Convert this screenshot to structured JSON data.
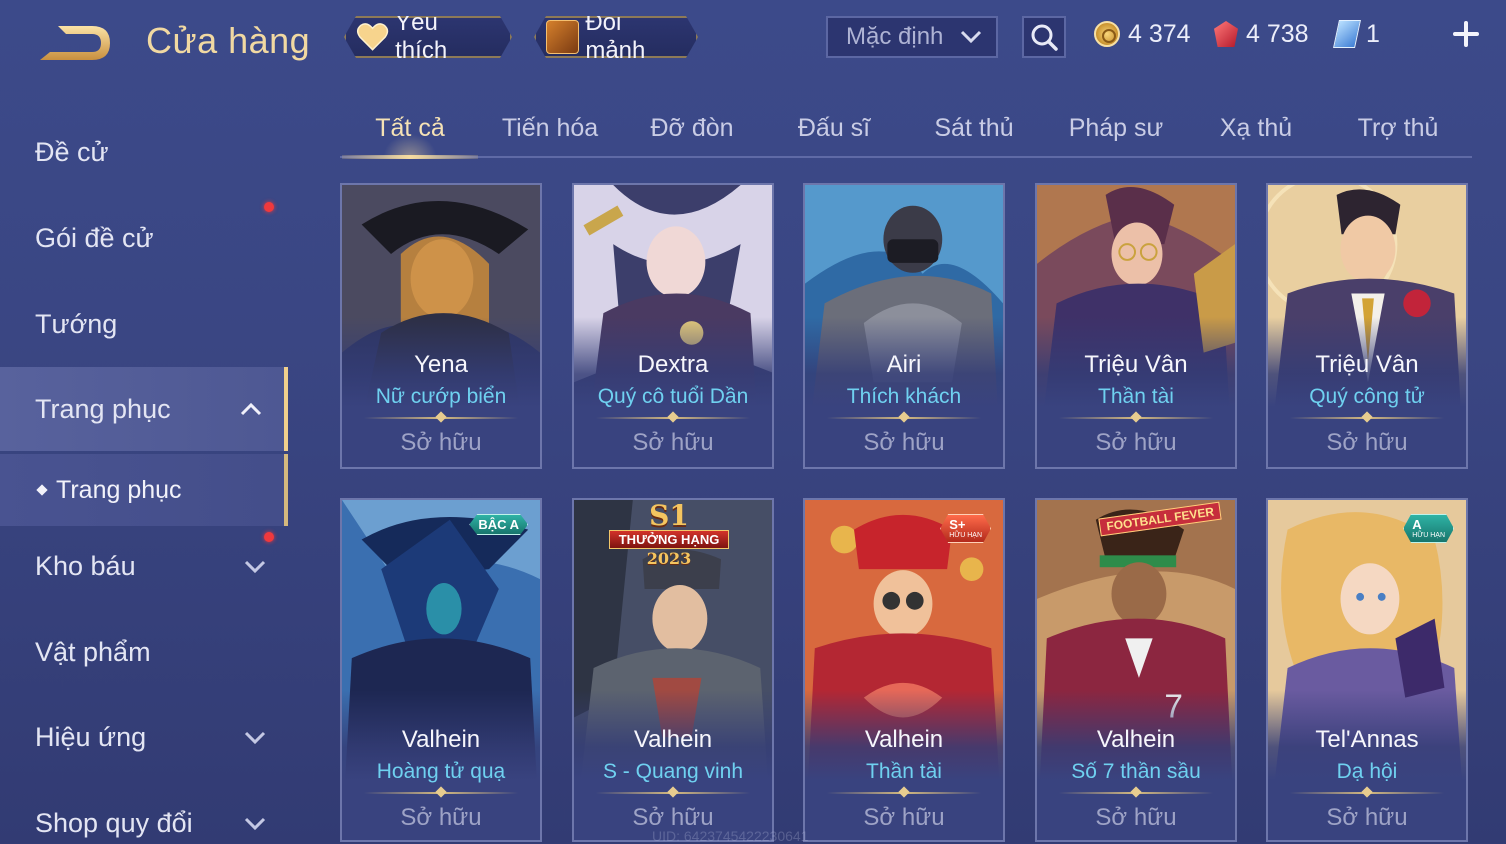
{
  "header": {
    "title": "Cửa hàng",
    "favorites_label": "Yêu thích",
    "fragments_label": "Đổi mảnh",
    "sort_value": "Mặc định"
  },
  "currencies": {
    "gold": "4 374",
    "ruby": "4 738",
    "token": "1"
  },
  "sidebar": {
    "items": [
      {
        "label": "Đề cử"
      },
      {
        "label": "Gói đề cử"
      },
      {
        "label": "Tướng"
      },
      {
        "label": "Trang phục"
      },
      {
        "label": "Kho báu"
      },
      {
        "label": "Vật phẩm"
      },
      {
        "label": "Hiệu ứng"
      },
      {
        "label": "Shop quy đổi"
      }
    ],
    "sub_item": "Trang phục"
  },
  "tabs": [
    "Tất cả",
    "Tiến hóa",
    "Đỡ đòn",
    "Đấu sĩ",
    "Sát thủ",
    "Pháp sư",
    "Xạ thủ",
    "Trợ thủ"
  ],
  "cards": [
    {
      "hero": "Yena",
      "skin": "Nữ cướp biển",
      "status": "Sở hữu",
      "accent": "#6a5a3c"
    },
    {
      "hero": "Dextra",
      "skin": "Quý cô tuổi Dần",
      "status": "Sở hữu",
      "accent": "#8e7aa8"
    },
    {
      "hero": "Airi",
      "skin": "Thích khách",
      "status": "Sở hữu",
      "accent": "#3b82c4"
    },
    {
      "hero": "Triệu Vân",
      "skin": "Thần tài",
      "status": "Sở hữu",
      "accent": "#8b3a4a"
    },
    {
      "hero": "Triệu Vân",
      "skin": "Quý công tử",
      "status": "Sở hữu",
      "accent": "#c9a46a"
    },
    {
      "hero": "Valhein",
      "skin": "Hoàng tử quạ",
      "status": "Sở hữu",
      "accent": "#2a5f9e",
      "badge": "BẬC A"
    },
    {
      "hero": "Valhein",
      "skin": "S - Quang vinh",
      "status": "Sở hữu",
      "accent": "#56606e",
      "season": {
        "s1": "S1",
        "rank": "THƯỞNG HẠNG",
        "year": "2023"
      }
    },
    {
      "hero": "Valhein",
      "skin": "Thần tài",
      "status": "Sở hữu",
      "accent": "#d24a38",
      "badge": "S+",
      "badge_sub": "HỮU HẠN"
    },
    {
      "hero": "Valhein",
      "skin": "Số 7 thần sầu",
      "status": "Sở hữu",
      "accent": "#8c2a3a",
      "football": "FOOTBALL FEVER"
    },
    {
      "hero": "Tel'Annas",
      "skin": "Dạ hội",
      "status": "Sở hữu",
      "accent": "#e0c89a",
      "badge": "A",
      "badge_sub": "HỮU HẠN"
    }
  ],
  "uid": "UID: 6423745422230641",
  "colors": {
    "gold_accent": "#f1d08c",
    "skin_name": "#6fd1f0",
    "background": "#3a4683"
  }
}
